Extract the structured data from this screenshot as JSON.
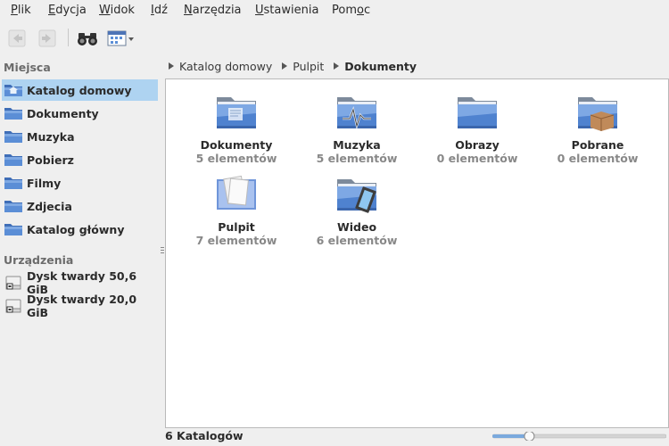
{
  "menu": [
    "Plik",
    "Edycja",
    "Widok",
    "Idź",
    "Narzędzia",
    "Ustawienia",
    "Pomoc"
  ],
  "menu_underline": [
    "P",
    "E",
    "W",
    "I",
    "N",
    "U",
    "o"
  ],
  "toolbar": {
    "back": "arrow-left-icon",
    "forward": "arrow-right-icon",
    "search": "binoculars-icon",
    "view": "view-mode-icon"
  },
  "sidebar": {
    "places_heading": "Miejsca",
    "places": [
      {
        "label": "Katalog domowy",
        "active": true
      },
      {
        "label": "Dokumenty"
      },
      {
        "label": "Muzyka"
      },
      {
        "label": "Pobierz"
      },
      {
        "label": "Filmy"
      },
      {
        "label": "Zdjecia"
      },
      {
        "label": "Katalog główny"
      }
    ],
    "devices_heading": "Urządzenia",
    "devices": [
      {
        "label": "Dysk twardy 50,6 GiB"
      },
      {
        "label": "Dysk twardy 20,0 GiB"
      }
    ]
  },
  "breadcrumb": [
    "Katalog domowy",
    "Pulpit",
    "Dokumenty"
  ],
  "folders": [
    {
      "name": "Dokumenty",
      "count": "5 elementów",
      "icon": "folder-documents-icon"
    },
    {
      "name": "Muzyka",
      "count": "5 elementów",
      "icon": "folder-music-icon"
    },
    {
      "name": "Obrazy",
      "count": "0 elementów",
      "icon": "folder-pictures-icon"
    },
    {
      "name": "Pobrane",
      "count": "0 elementów",
      "icon": "folder-downloads-icon"
    },
    {
      "name": "Pulpit",
      "count": "7 elementów",
      "icon": "folder-desktop-icon"
    },
    {
      "name": "Wideo",
      "count": "6 elementów",
      "icon": "folder-video-icon"
    }
  ],
  "status": "6 Katalogów",
  "zoom_fraction": 0.2,
  "colors": {
    "selection": "#aed3f1",
    "folder": "#5b8ed6"
  }
}
